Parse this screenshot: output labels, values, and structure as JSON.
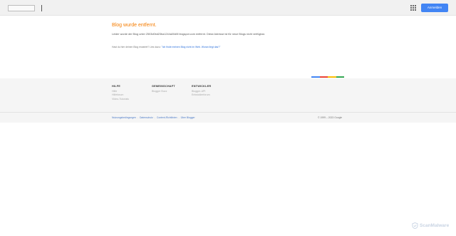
{
  "header": {
    "signin_label": "Anmelden"
  },
  "main": {
    "headline": "Blog wurde entfernt.",
    "message": "Leider wurde der Blog unter 2503d0bd23ba1244a00d0f.blogspot.com entfernt. Diese Adresse ist für neue Blogs nicht verfügbar.",
    "hint_prefix": "Hast du hier deinen Blog erwartet? Lies dazu: ",
    "hint_link": "\"Ich finde meinen Blog nicht im Web. Woran liegt das?\""
  },
  "colorbar": [
    "#4285f4",
    "#ea4335",
    "#fbbc05",
    "#34a853"
  ],
  "footer": {
    "columns": [
      {
        "heading": "HILFE",
        "links": [
          "Hilfe",
          "Hilfeforum",
          "Video-Tutorials"
        ]
      },
      {
        "heading": "GEMEINSCHAFT",
        "links": [
          "Blogger Buzz"
        ]
      },
      {
        "heading": "ENTWICKLER",
        "links": [
          "Blogger-API",
          "Entwicklerforum"
        ]
      }
    ],
    "legal_links": [
      "Nutzungsbedingungen",
      "Datenschutz",
      "Content-Richtlinien",
      "Über Blogger"
    ],
    "legal_separator": "-",
    "copyright": "© 1999 – 2023 Google"
  },
  "watermark": {
    "text": "ScanMalware"
  }
}
